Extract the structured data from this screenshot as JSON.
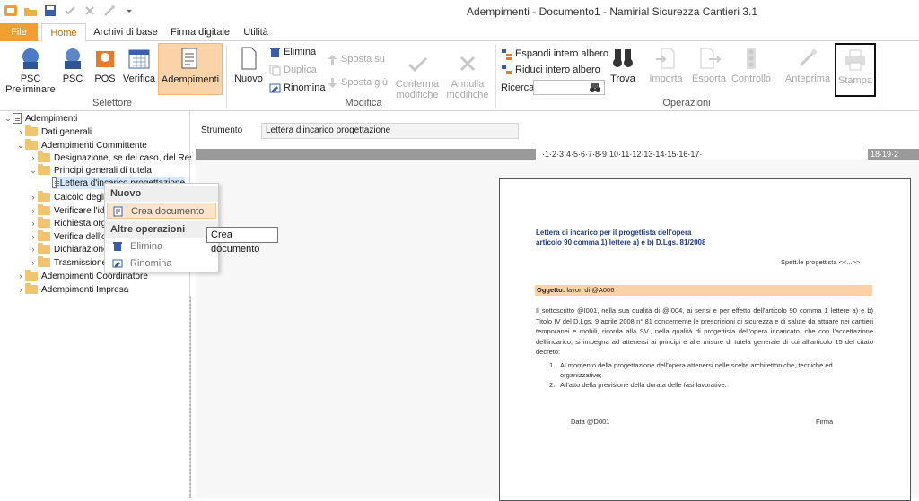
{
  "window": {
    "title": "Adempimenti - Documento1 - Namirial Sicurezza Cantieri 3.1"
  },
  "tabs": {
    "file": "File",
    "home": "Home",
    "archivi": "Archivi di base",
    "firma": "Firma digitale",
    "utilita": "Utilità"
  },
  "ribbon": {
    "selettore": {
      "label": "Selettore",
      "psc_prelim_1": "PSC",
      "psc_prelim_2": "Preliminare",
      "psc": "PSC",
      "pos": "POS",
      "verifica": "Verifica",
      "adempimenti": "Adempimenti"
    },
    "modifica": {
      "label": "Modifica",
      "nuovo": "Nuovo",
      "elimina": "Elimina",
      "duplica": "Duplica",
      "rinomina": "Rinomina",
      "sposta_su": "Sposta su",
      "sposta_giu": "Sposta giù",
      "conferma_1": "Conferma",
      "conferma_2": "modifiche",
      "annulla_1": "Annulla",
      "annulla_2": "modifiche"
    },
    "operazioni": {
      "label": "Operazioni",
      "espandi": "Espandi intero albero",
      "riduci": "Riduci intero albero",
      "ricerca": "Ricerca",
      "trova": "Trova",
      "importa": "Importa",
      "esporta": "Esporta",
      "controllo": "Controllo",
      "anteprima": "Anteprima",
      "stampa": "Stampa"
    }
  },
  "tree": {
    "root": "Adempimenti",
    "dati_generali": "Dati generali",
    "adempimenti_committente": "Adempimenti Committente",
    "designazione": "Designazione, se del caso, del Respor",
    "principi": "Principi generali di tutela",
    "lettera": "Lettera d'incarico progettazione",
    "calcolo": "Calcolo degli",
    "verificare": "Verificare l'ido",
    "richiesta": "Richiesta org",
    "verifica_dell": "Verifica dell'o",
    "dichiarazione": "Dichiarazione",
    "trasmissione": "Trasmissione",
    "coordinatore": "Adempimenti Coordinatore",
    "impresa": "Adempimenti Impresa"
  },
  "context_menu": {
    "nuovo_header": "Nuovo",
    "crea": "Crea documento",
    "altre_header": "Altre operazioni",
    "elimina": "Elimina",
    "rinomina": "Rinomina"
  },
  "tooltip": "Crea documento",
  "strumento": {
    "label": "Strumento",
    "value": "Lettera d'incarico progettazione"
  },
  "ruler": {
    "text": "·1·2·3·4·5·6·7·8·9·10·11·12·13·14·15·16·17·",
    "right": "18·19·2"
  },
  "document": {
    "title_line1": "Lettera di incarico per il progettista dell'opera",
    "title_line2": "articolo 90 comma 1) lettere a) e b) D.Lgs. 81/2008",
    "spett": "Spett.le progettista <<...>>",
    "oggetto_label": "Oggetto:",
    "oggetto_text": " lavori di @A006",
    "paragraph": "Il sottoscritto @I001, nella sua qualità di @I004, ai sensi e per effetto dell'articolo 90 comma 1 lettere a) e b) Titolo IV del D.Lgs. 9 aprile 2008 n° 81 concernente le prescrizioni di sicurezza e di salute da attuare nei cantieri temporanei e mobili, ricorda alla SV., nella qualità di progettista dell'opera incaricato, che con l'accettazione dell'incarico, si impegna ad attenersi ai principi e alle misure di tutela generale di cui all'articolo 15 del citato decreto:",
    "item1_num": "1.",
    "item1": "Al momento della progettazione dell'opera attenersi nelle scelte architettoniche, tecniche ed organizzative;",
    "item2_num": "2.",
    "item2": "All'atto della previsione della durata delle fasi lavorative.",
    "data": "Data @D001",
    "firma": "Firma"
  },
  "colors": {
    "accent": "#f0a030",
    "active_button": "#fbd3a8",
    "oggetto_bg": "#fbd2a8",
    "doc_title": "#1f3c88"
  }
}
